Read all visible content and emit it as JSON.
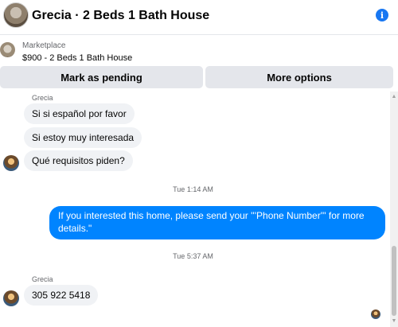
{
  "header": {
    "title": "Grecia · 2 Beds 1 Bath House",
    "info_icon": "info-icon"
  },
  "marketplace": {
    "label": "Marketplace",
    "detail": "$900 - 2 Beds 1 Bath House"
  },
  "actions": {
    "mark_pending": "Mark as pending",
    "more_options": "More options"
  },
  "messages": {
    "sender_top": "Grecia",
    "msg1": "Si si español por favor",
    "msg2": "Si estoy muy interesada",
    "msg3": "Qué requisitos piden?",
    "time1": "Tue 1:14 AM",
    "outgoing": "If you interested this home, please send your '''Phone Number''' for more details.\"",
    "time2": "Tue 5:37 AM",
    "sender_bottom": "Grecia",
    "msg4": "305 922 5418"
  },
  "colors": {
    "outgoing_bubble": "#0084ff",
    "incoming_bubble": "#f0f2f5",
    "accent": "#1877f2"
  }
}
